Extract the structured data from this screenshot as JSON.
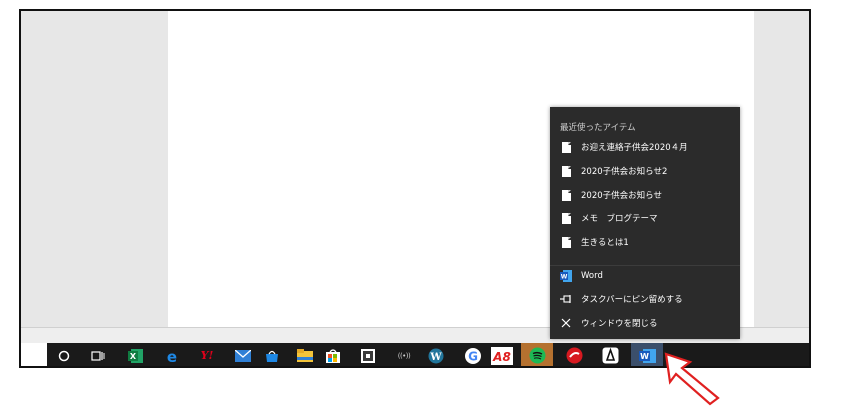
{
  "jumplist": {
    "heading": "最近使ったアイテム",
    "recent_items": [
      {
        "label": "お迎え連絡子供会2020４月",
        "icon": "document-icon"
      },
      {
        "label": "2020子供会お知らせ2",
        "icon": "document-icon"
      },
      {
        "label": "2020子供会お知らせ",
        "icon": "document-icon"
      },
      {
        "label": "メモ　ブログテーマ",
        "icon": "document-icon"
      },
      {
        "label": "生きるとは1",
        "icon": "document-icon"
      }
    ],
    "app_item": {
      "label": "Word",
      "icon": "word-icon"
    },
    "pin_item": {
      "label": "タスクバーにピン留めする",
      "icon": "pin-icon"
    },
    "close_item": {
      "label": "ウィンドウを閉じる",
      "icon": "close-icon"
    }
  },
  "taskbar": {
    "icons": [
      "cortana-circle-icon",
      "task-view-icon",
      "excel-icon",
      "edge-icon",
      "yahoo-icon",
      "mail-icon",
      "store-bag-icon",
      "file-explorer-icon",
      "ms-store-icon",
      "photo-icon",
      "radio-icon",
      "wordpress-icon",
      "google-icon",
      "a8-icon",
      "spotify-icon",
      "security-icon",
      "maps-icon",
      "word-icon"
    ],
    "a8_text": "A8",
    "word_letter": "W",
    "excel_letter": "X",
    "google_letter": "G",
    "yahoo_letter": "Y!"
  },
  "colors": {
    "taskbar_bg": "#1a1a1a",
    "jumplist_bg": "#2b2b2b",
    "word_blue": "#2b579a",
    "excel_green": "#1e7145",
    "arrow_red": "#e02020"
  }
}
